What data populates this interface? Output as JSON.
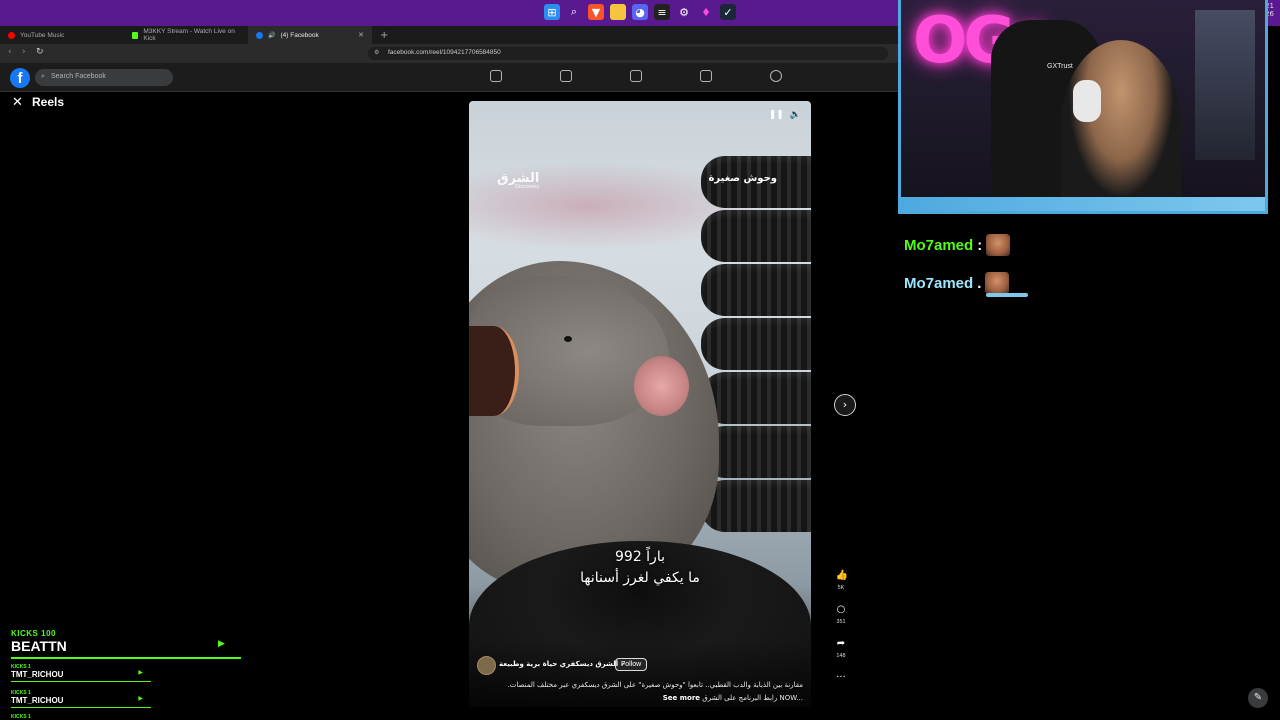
{
  "os": {
    "clock_top": "21",
    "clock_bottom": "26"
  },
  "tabs": [
    {
      "label": "YouTube Music",
      "color": "#ff0000"
    },
    {
      "label": "M3KKY Stream - Watch Live on Kick",
      "color": "#53fc18"
    },
    {
      "label": "(4) Facebook",
      "color": "#1877f2"
    }
  ],
  "address": {
    "url": "facebook.com/reel/1094217706584850"
  },
  "facebook": {
    "logo": "f",
    "search_placeholder": "Search Facebook",
    "nav_icons": [
      "home-icon",
      "feed-icon",
      "video-icon",
      "marketplace-icon",
      "groups-icon"
    ]
  },
  "reels": {
    "close_symbol": "✕",
    "title": "Reels"
  },
  "video": {
    "brand_logo": "الشرق",
    "brand_sub": "Discovery",
    "show_title": "وحوش صغيرة",
    "subtitle_line1": "992 باراً",
    "subtitle_line2": "ما يكفي لغرز أسنانها",
    "page_name": "الشرق ديسكفري حياة برية وطبيعة",
    "follow_label": "Follow",
    "caption_line1": "مقارنة بين الذبابة والدب القطبي.. تابعوا \"وحوش صغيرة\" على الشرق ديسكفري عبر مختلف المنصات.",
    "caption_line2": "رابط البرنامج على الشرق NOW...",
    "see_more": "See more"
  },
  "actions": {
    "likes": "5K",
    "comments": "351",
    "shares": "148",
    "more": "···"
  },
  "stream_overlay": {
    "neon_text": "OGs",
    "chair_brand": "GXTrust",
    "chat": [
      {
        "user": "Mo7amed",
        "sep": ":"
      },
      {
        "user": "Mo7amed",
        "sep": "."
      }
    ],
    "kicks": {
      "header": "KICKS 100",
      "top_user": "BEATTN",
      "rows": [
        {
          "label": "KICKS 1",
          "user": "TMT_RICHOU"
        },
        {
          "label": "KICKS 1",
          "user": "TMT_RICHOU"
        },
        {
          "label": "KICKS 1",
          "user": ""
        }
      ]
    }
  }
}
